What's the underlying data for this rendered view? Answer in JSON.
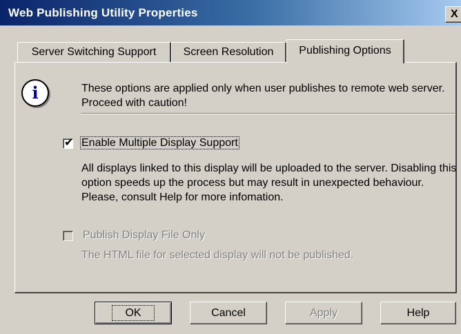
{
  "window": {
    "title": "Web Publishing Utility Properties",
    "close_label": "X"
  },
  "tabs": [
    {
      "label": "Server Switching Support",
      "active": false
    },
    {
      "label": "Screen Resolution",
      "active": false
    },
    {
      "label": "Publishing Options",
      "active": true
    }
  ],
  "notice": {
    "icon": "info-icon",
    "icon_glyph": "i",
    "text": "These options are applied only when user publishes to remote web server. Proceed with caution!"
  },
  "options": [
    {
      "label": "Enable Multiple Display Support",
      "checked": true,
      "enabled": true,
      "description": "All displays linked to this display will be uploaded to the server. Disabling this option speeds up the process but may result in unexpected behaviour. Please, consult Help for more infomation."
    },
    {
      "label": "Publish Display File Only",
      "checked": false,
      "enabled": false,
      "description": "The HTML file for selected display will not be published."
    }
  ],
  "buttons": {
    "ok": "OK",
    "cancel": "Cancel",
    "apply": "Apply",
    "help": "Help"
  }
}
